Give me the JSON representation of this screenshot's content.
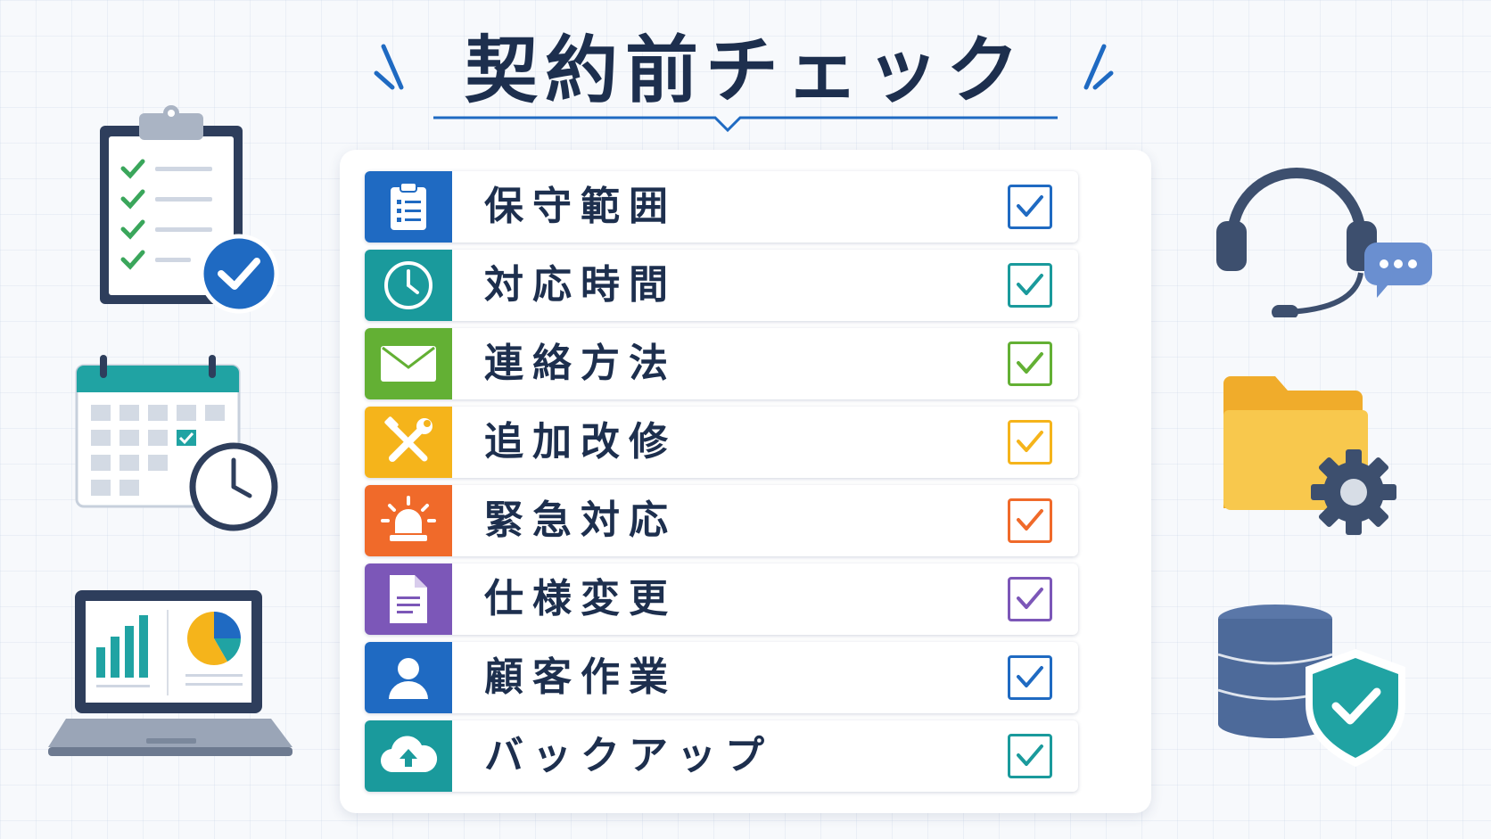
{
  "title": "契約前チェック",
  "items": [
    {
      "label": "保守範囲",
      "icon": "clipboard-list-icon",
      "color": "#1f6ac2",
      "checked": true
    },
    {
      "label": "対応時間",
      "icon": "clock-icon",
      "color": "#1a9a9c",
      "checked": true
    },
    {
      "label": "連絡方法",
      "icon": "envelope-icon",
      "color": "#63b034",
      "checked": true
    },
    {
      "label": "追加改修",
      "icon": "tools-icon",
      "color": "#f5b41b",
      "checked": true
    },
    {
      "label": "緊急対応",
      "icon": "alarm-light-icon",
      "color": "#f06a2a",
      "checked": true
    },
    {
      "label": "仕様変更",
      "icon": "document-icon",
      "color": "#7c57b8",
      "checked": true
    },
    {
      "label": "顧客作業",
      "icon": "user-icon",
      "color": "#1f6ac2",
      "checked": true
    },
    {
      "label": "バックアップ",
      "icon": "cloud-upload-icon",
      "color": "#1a9a9c",
      "checked": true
    }
  ],
  "decorations": {
    "left": [
      "clipboard-checklist-icon",
      "calendar-clock-icon",
      "laptop-chart-icon"
    ],
    "right": [
      "headset-chat-icon",
      "folder-gear-icon",
      "database-shield-icon"
    ]
  }
}
